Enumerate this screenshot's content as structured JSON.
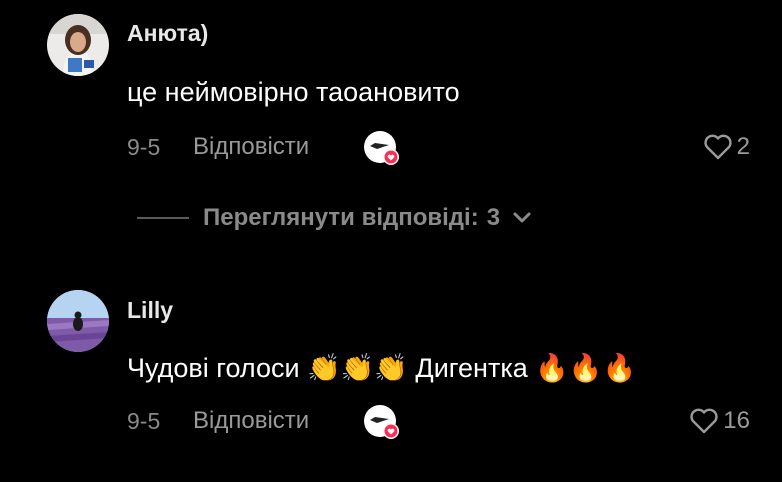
{
  "comments": [
    {
      "username": "Анюта)",
      "text": "це неймовірно таоановито",
      "date": "9-5",
      "reply_label": "Відповісти",
      "likes": "2",
      "avatar_icon": "user-photo-avatar",
      "creator_liked_icon": "creator-liked-heart-icon"
    },
    {
      "username": "Lilly",
      "text": "Чудові голоси 👏👏👏 Дигентка 🔥🔥🔥",
      "date": "9-5",
      "reply_label": "Відповісти",
      "likes": "16",
      "avatar_icon": "lavender-field-avatar",
      "creator_liked_icon": "creator-liked-heart-icon"
    }
  ],
  "view_replies": {
    "label": "Переглянути відповіді:",
    "count": "3",
    "icon": "chevron-down-icon"
  },
  "colors": {
    "background": "#000000",
    "text_primary": "#ffffff",
    "text_secondary": "#9a9a9a",
    "heart_badge": "#fe2c55"
  }
}
